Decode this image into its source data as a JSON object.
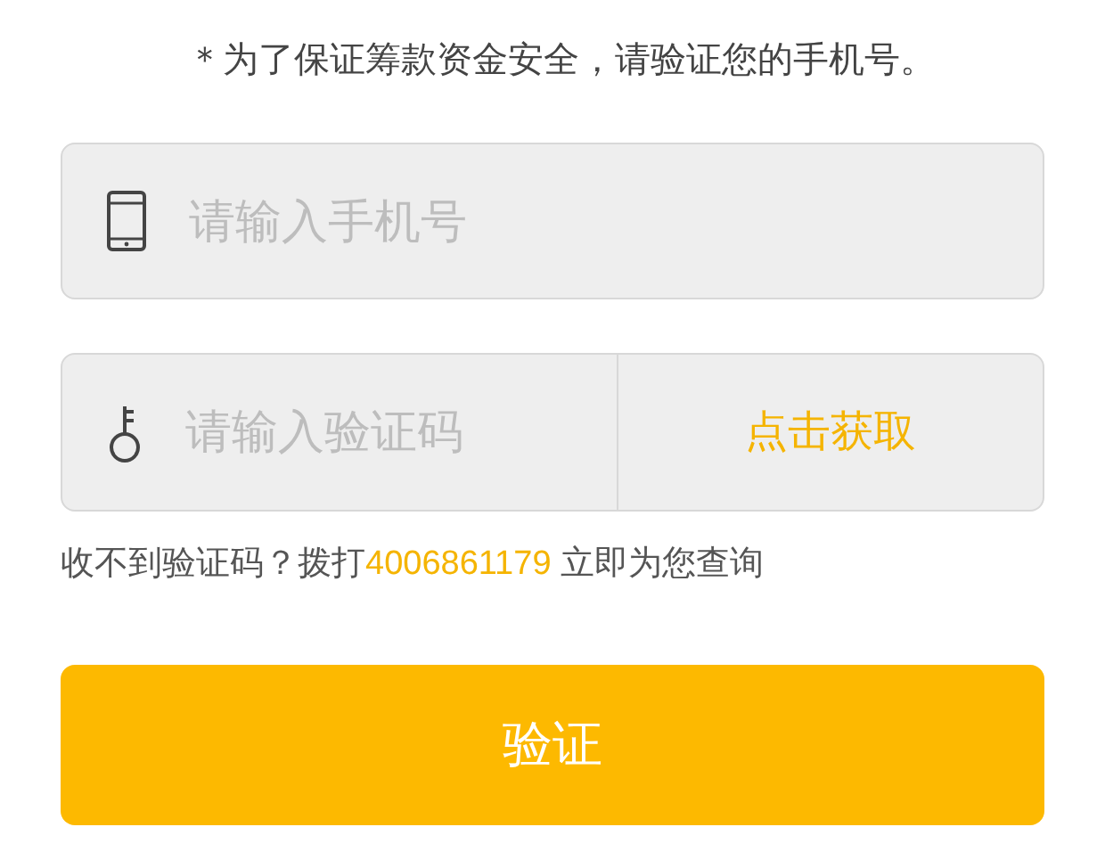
{
  "notice": "＊为了保证筹款资金安全，请验证您的手机号。",
  "phone_field": {
    "placeholder": "请输入手机号"
  },
  "code_field": {
    "placeholder": "请输入验证码"
  },
  "get_code_button": "点击获取",
  "help": {
    "prefix": "收不到验证码？拨打",
    "phone_link": "4006861179",
    "suffix": " 立即为您查询"
  },
  "verify_button": "验证"
}
